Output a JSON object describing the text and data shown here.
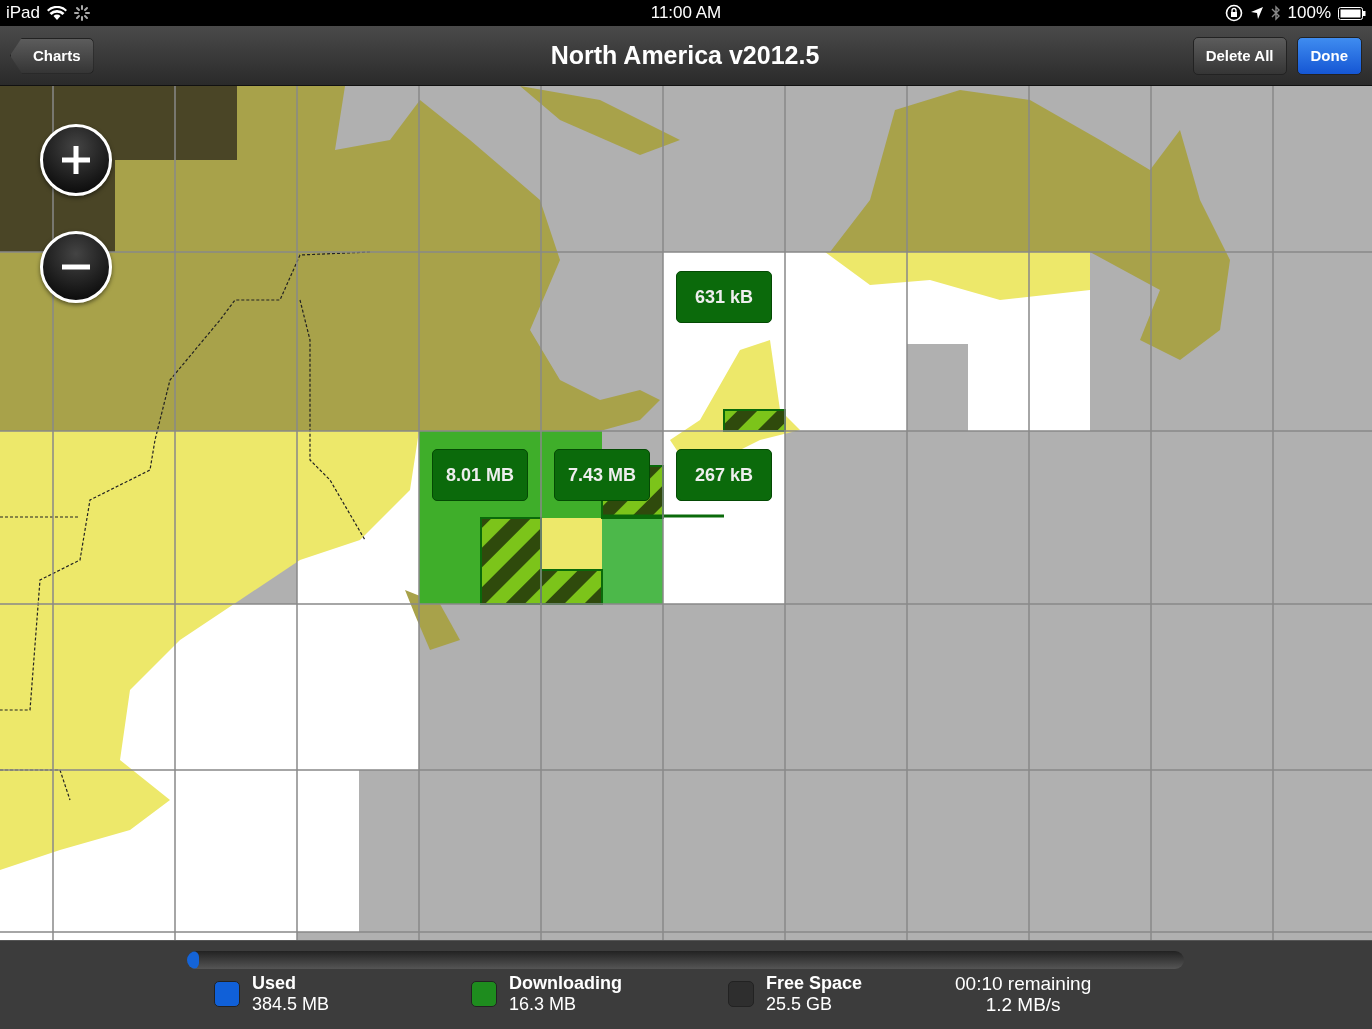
{
  "status_bar": {
    "device": "iPad",
    "time": "11:00 AM",
    "battery": "100%"
  },
  "nav_bar": {
    "back": "Charts",
    "title": "North America v2012.5",
    "buttons": [
      {
        "label": "Delete All",
        "kind": "plain"
      },
      {
        "label": "Done",
        "kind": "primary"
      }
    ]
  },
  "map": {
    "tiles": [
      {
        "label": "631 kB"
      },
      {
        "label": "8.01 MB"
      },
      {
        "label": "7.43 MB"
      },
      {
        "label": "267 kB"
      }
    ]
  },
  "storage": {
    "level": 0.012,
    "legend": [
      {
        "label": "Used",
        "value": "384.5 MB",
        "color": "#1060d8"
      },
      {
        "label": "Downloading",
        "value": "16.3 MB",
        "color": "#1e8c1e"
      },
      {
        "label": "Free Space",
        "value": "25.5 GB",
        "color": "#2e2e2e"
      }
    ],
    "remaining": "00:10 remaining",
    "rate": "1.2 MB/s"
  }
}
